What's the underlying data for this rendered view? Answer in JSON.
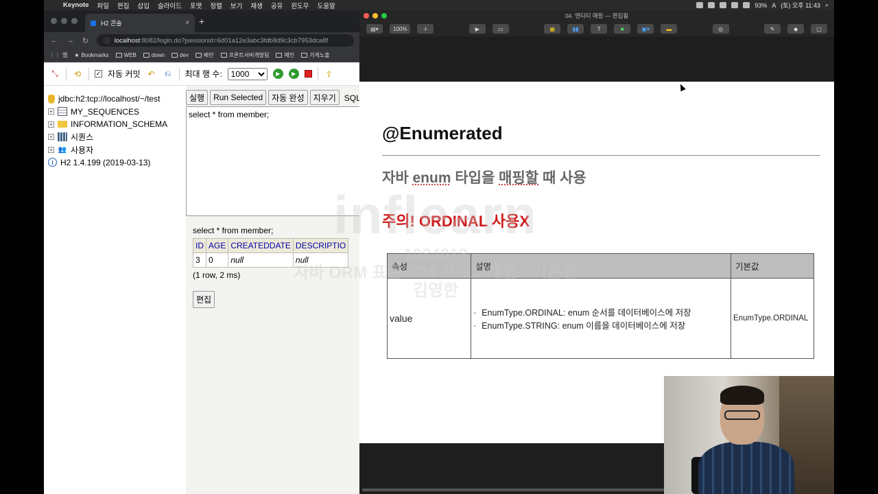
{
  "menubar": {
    "apple": "",
    "items": [
      "Keynote",
      "파일",
      "편집",
      "삽입",
      "슬라이드",
      "포맷",
      "정렬",
      "보기",
      "재생",
      "공유",
      "윈도우",
      "도움말"
    ],
    "battery": "93%",
    "input_method": "A",
    "clock": "(토) 오후 11:43"
  },
  "browser": {
    "tab_title": "H2 콘솔",
    "tab_close": "×",
    "new_tab": "+",
    "url_host": "localhost",
    "url_path": ":8082/login.do?jsessionid=6d01a12e3abc3fdb8d9c3cb7953dca8f",
    "bookmarks": [
      "앱",
      "Bookmarks",
      "WEB",
      "down",
      "dev",
      "베민",
      "프론트서버개발팀",
      "메인",
      "가게노출"
    ]
  },
  "h2": {
    "toolbar": {
      "auto_commit_label": "자동 커밋",
      "max_rows_label": "최대 행 수:",
      "max_rows_value": "1000"
    },
    "tree": {
      "connection": "jdbc:h2:tcp://localhost/~/test",
      "items": [
        "MY_SEQUENCES",
        "INFORMATION_SCHEMA",
        "시퀀스",
        "사용자"
      ],
      "version": "H2 1.4.199 (2019-03-13)"
    },
    "buttons": {
      "run": "실행",
      "run_selected": "Run Selected",
      "auto_complete": "자동 완성",
      "clear": "지우기",
      "sql_label": "SQL 문"
    },
    "editor_text": "select * from member;",
    "result": {
      "query": "select * from member;",
      "columns": [
        "ID",
        "AGE",
        "CREATEDDATE",
        "DESCRIPTIO"
      ],
      "row": [
        "3",
        "0",
        "null",
        "null"
      ],
      "rows_info": "(1 row, 2 ms)",
      "edit_button": "편집"
    }
  },
  "keynote": {
    "window_title": "04. 엔티티 매핑 — 편집됨",
    "zoom": "100%",
    "slide": {
      "title": "@Enumerated",
      "subtitle_pre": "자바 ",
      "subtitle_u1": "enum",
      "subtitle_mid": " 타입을 ",
      "subtitle_u2": "매핑할",
      "subtitle_post": " 때 사용",
      "warning": "주의! ORDINAL 사용X",
      "table": {
        "headers": [
          "속성",
          "설명",
          "기본값"
        ],
        "property": "value",
        "desc_items": [
          "EnumType.ORDINAL: enum 순서를 데이터베이스에 저장",
          "EnumType.STRING: enum 이름을 데이터베이스에 저장"
        ],
        "default": "EnumType.ORDINAL"
      }
    }
  },
  "watermark": {
    "logo": "inflearn",
    "id": "1084018",
    "course": "자바 ORM 표준 JPA 프로그래밍 - 기본편",
    "author": "김영한"
  }
}
